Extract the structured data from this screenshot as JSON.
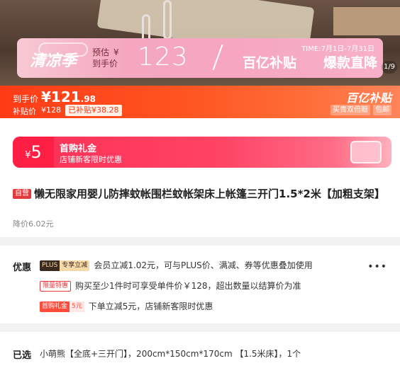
{
  "banner": {
    "season": "清凉季",
    "pre_label_top": "预估",
    "pre_label_bottom": "到手价",
    "yen": "¥",
    "price": "123",
    "time": "TIME:7月1日-7月31日",
    "subsidy": "百亿补贴",
    "hot": "爆款直降",
    "pager": "1/9"
  },
  "pricebar": {
    "final_label": "到手价",
    "final_price_int": "¥121",
    "final_price_dec": ".98",
    "subsidy_label": "补贴价",
    "subsidy_price": "¥128",
    "subsidy_tag": "已补贴¥38.28",
    "logo": "百亿补贴",
    "tag1": "买贵双倍赔",
    "tag2": "包邮"
  },
  "coupon": {
    "yen": "¥",
    "amount": "5",
    "title": "首购礼金",
    "desc": "店铺新客限时优惠"
  },
  "product": {
    "badge": "自营",
    "title": "懒无限家用婴儿防摔蚊帐围栏蚊帐架床上帐篷三开门1.5*2米【加粗支架】",
    "price_drop": "降价6.02元"
  },
  "offers": {
    "label": "优惠",
    "plus_a": "PLUS",
    "plus_b": "专享立减",
    "plus_text": "会员立减1.02元，可与PLUS价、满减、券等优惠叠加使用",
    "limit_tag": "限量特惠",
    "limit_text": "购买至少1件时可享受单件价￥128，超出数量以结算价为准",
    "gift_a": "首购礼金",
    "gift_b": "5元",
    "gift_text": "下单立减5元，店铺新客限时优惠",
    "more": "•••"
  },
  "selected": {
    "label": "已选",
    "value": "小萌熊【全底+三开门】，200cm*150cm*170cm 【1.5米床】，1个"
  }
}
